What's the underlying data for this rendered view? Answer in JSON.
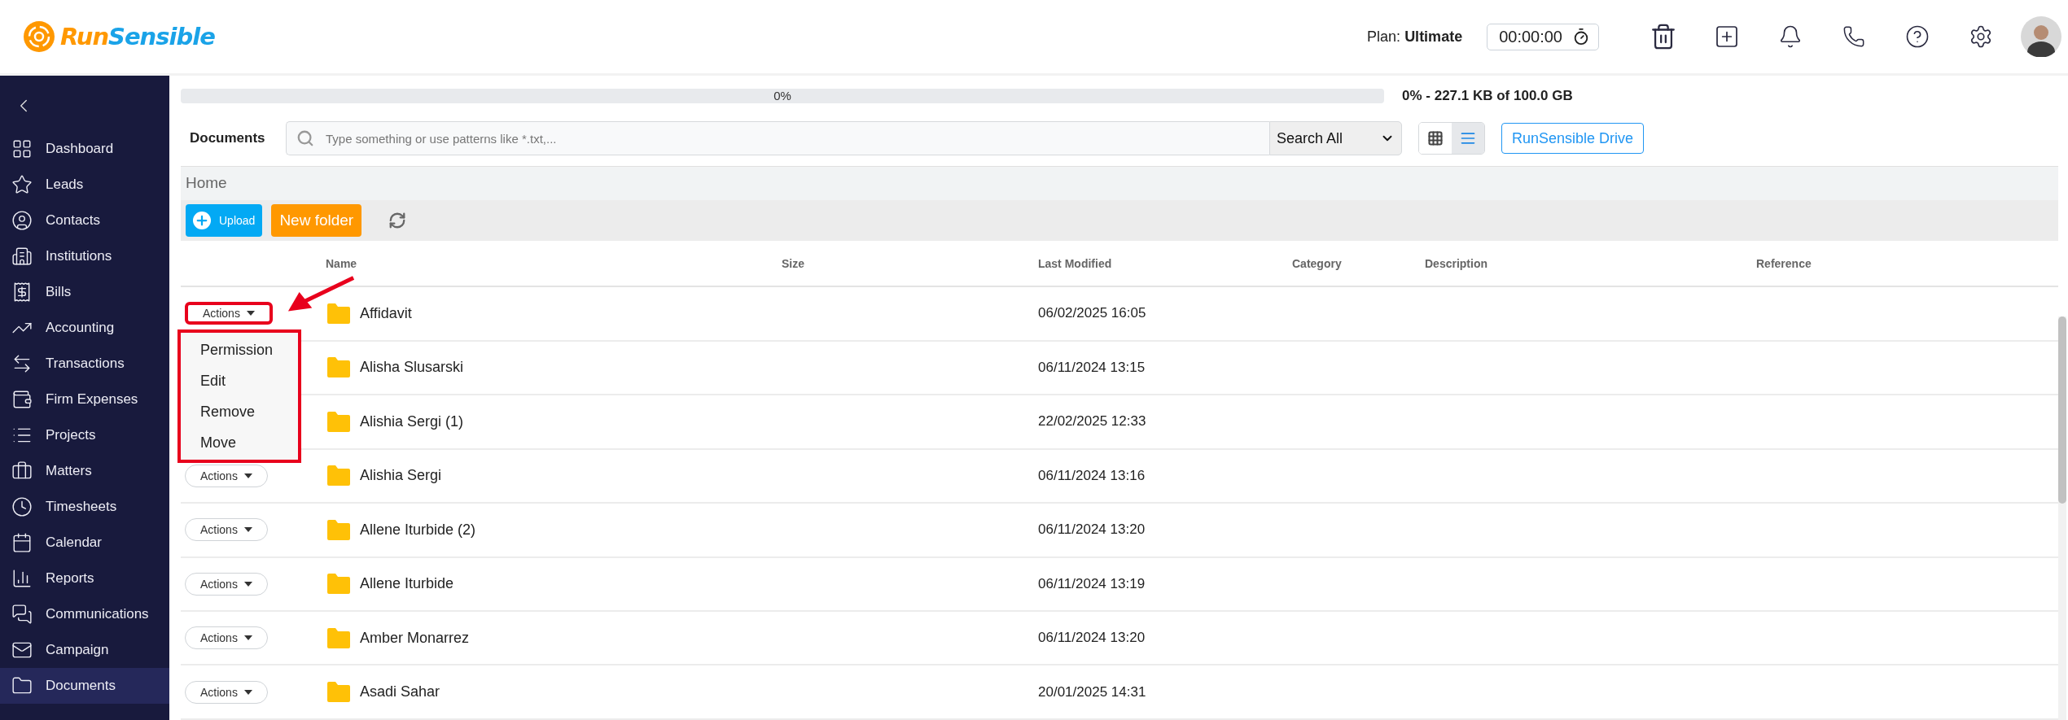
{
  "header": {
    "logo_parts": [
      "Run",
      "Sensible"
    ],
    "plan_label": "Plan:",
    "plan_name": "Ultimate",
    "timer": "00:00:00"
  },
  "sidebar": {
    "items": [
      {
        "label": "Dashboard",
        "selected": false
      },
      {
        "label": "Leads",
        "selected": false
      },
      {
        "label": "Contacts",
        "selected": false
      },
      {
        "label": "Institutions",
        "selected": false
      },
      {
        "label": "Bills",
        "selected": false
      },
      {
        "label": "Accounting",
        "selected": false
      },
      {
        "label": "Transactions",
        "selected": false
      },
      {
        "label": "Firm Expenses",
        "selected": false
      },
      {
        "label": "Projects",
        "selected": false
      },
      {
        "label": "Matters",
        "selected": false
      },
      {
        "label": "Timesheets",
        "selected": false
      },
      {
        "label": "Calendar",
        "selected": false
      },
      {
        "label": "Reports",
        "selected": false
      },
      {
        "label": "Communications",
        "selected": false
      },
      {
        "label": "Campaign",
        "selected": false
      },
      {
        "label": "Documents",
        "selected": true
      }
    ]
  },
  "storage": {
    "level": 0,
    "percent": "0%",
    "summary": "0% - 227.1 KB of 100.0 GB"
  },
  "toolbar": {
    "title": "Documents",
    "search_placeholder": "Type something or use patterns like *.txt,...",
    "search_scope": "Search All",
    "views": [
      {
        "kind": "grid",
        "selected": false
      },
      {
        "kind": "list",
        "selected": true
      }
    ],
    "drive_button": "RunSensible Drive"
  },
  "breadcrumb": "Home",
  "actions": {
    "upload": "Upload",
    "new_folder": "New folder"
  },
  "table": {
    "columns": [
      "Name",
      "Size",
      "Last Modified",
      "Category",
      "Description",
      "Reference"
    ],
    "menu": [
      "Permission",
      "Edit",
      "Remove",
      "Move"
    ],
    "rows": [
      {
        "actions": "Actions",
        "name": "Affidavit",
        "modified": "06/02/2025 16:05",
        "expanded": true,
        "highlighted": true
      },
      {
        "name": "Alisha Slusarski",
        "modified": "06/11/2024 13:15",
        "expanded": false,
        "highlighted": false
      },
      {
        "name": "Alishia Sergi (1)",
        "modified": "22/02/2025 12:33",
        "expanded": false,
        "highlighted": false
      },
      {
        "actions": "Actions",
        "name": "Alishia Sergi",
        "modified": "06/11/2024 13:16",
        "expanded": false,
        "highlighted": false
      },
      {
        "actions": "Actions",
        "name": "Allene Iturbide (2)",
        "modified": "06/11/2024 13:20",
        "expanded": false,
        "highlighted": false
      },
      {
        "actions": "Actions",
        "name": "Allene Iturbide",
        "modified": "06/11/2024 13:19",
        "expanded": false,
        "highlighted": false
      },
      {
        "actions": "Actions",
        "name": "Amber Monarrez",
        "modified": "06/11/2024 13:20",
        "expanded": false,
        "highlighted": false
      },
      {
        "actions": "Actions",
        "name": "Asadi Sahar",
        "modified": "20/01/2025 14:31",
        "expanded": false,
        "highlighted": false
      }
    ]
  }
}
